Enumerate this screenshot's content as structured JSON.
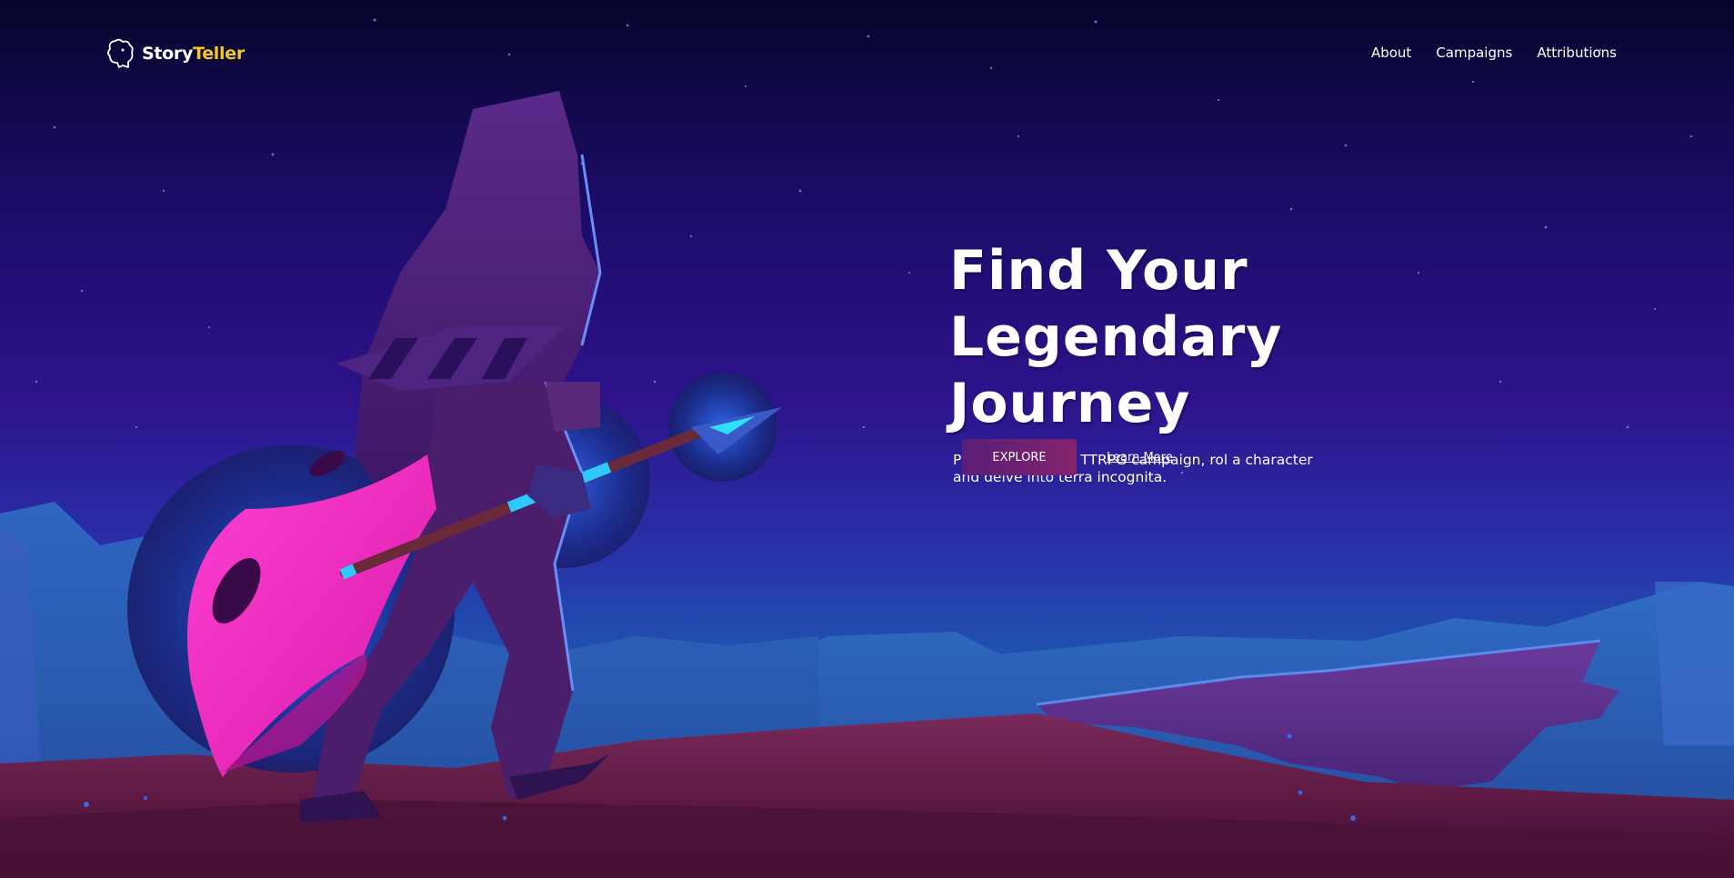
{
  "brand": {
    "name_part1": "Story",
    "name_part2": "Teller",
    "logo_icon": "dragon-icon"
  },
  "nav": {
    "items": [
      {
        "label": "About"
      },
      {
        "label": "Campaigns"
      },
      {
        "label": "Attributions"
      }
    ]
  },
  "hero": {
    "title_line1": "Find Your",
    "title_line2": "Legendary Journey",
    "subtitle": "Pick your favorite TTRPG campaign, rol a character and delve into terra incognita.",
    "primary_button": "EXPLORE",
    "secondary_link": "Learn More"
  },
  "colors": {
    "sky_top": "#07052b",
    "sky_mid": "#2a1080",
    "horizon": "#1c5aa8",
    "ground": "#6b1f48",
    "accent_pink": "#ff2ec8",
    "brand_yellow": "#f3c623",
    "button": "#6a1f72"
  }
}
